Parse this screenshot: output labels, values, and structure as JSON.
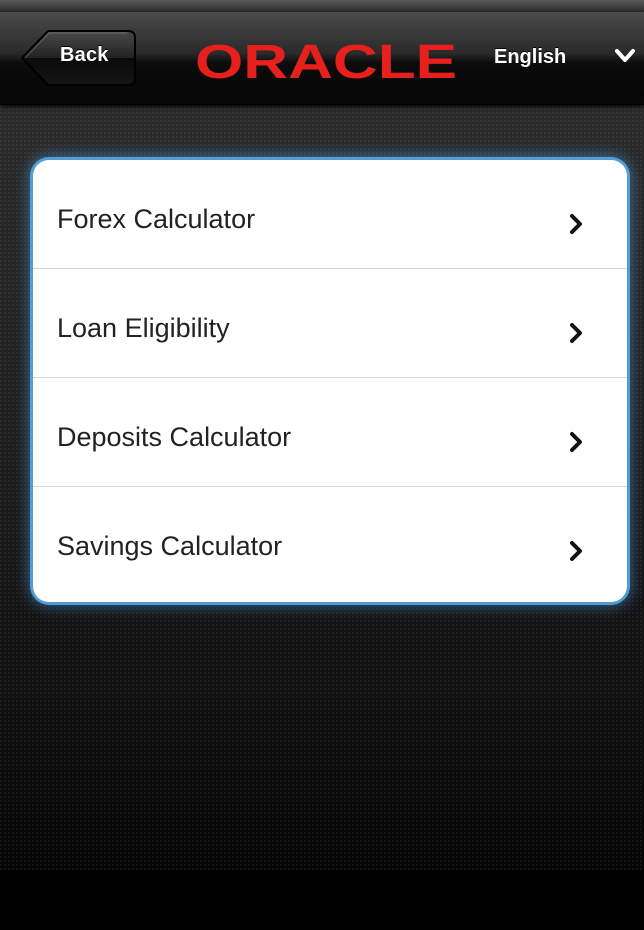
{
  "header": {
    "back_label": "Back",
    "logo_text": "ORACLE",
    "brand_color": "#e5201d",
    "language": {
      "selected": "English",
      "icon": "chevron-down-icon"
    }
  },
  "menu": {
    "accent_color": "#5aaae6",
    "items": [
      {
        "label": "Forex Calculator",
        "icon": "chevron-right-icon"
      },
      {
        "label": "Loan Eligibility",
        "icon": "chevron-right-icon"
      },
      {
        "label": "Deposits Calculator",
        "icon": "chevron-right-icon"
      },
      {
        "label": "Savings Calculator",
        "icon": "chevron-right-icon"
      }
    ]
  }
}
